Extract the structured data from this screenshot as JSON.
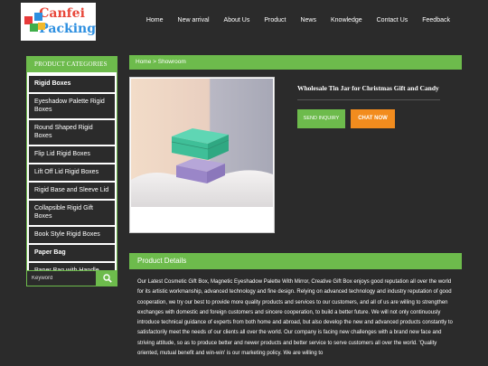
{
  "logo": {
    "line1": "Canfei",
    "line2": "Packing"
  },
  "nav": [
    "Home",
    "New arrival",
    "About Us",
    "Product",
    "News",
    "Knowledge",
    "Contact Us",
    "Feedback"
  ],
  "sidebar": {
    "heading": "PRODUCT CATEGORIES",
    "items": [
      {
        "label": "Rigid Boxes",
        "bold": true
      },
      {
        "label": "Eyeshadow Palette Rigid Boxes",
        "bold": false
      },
      {
        "label": "Round Shaped Rigid Boxes",
        "bold": false
      },
      {
        "label": "Flip Lid Rigid Boxes",
        "bold": false
      },
      {
        "label": "Lift Off Lid Rigid Boxes",
        "bold": false
      },
      {
        "label": "Rigid Base and Sleeve Lid",
        "bold": false
      },
      {
        "label": "Collapsible Rigid Gift Boxes",
        "bold": false
      },
      {
        "label": "Book Style Rigid Boxes",
        "bold": false
      },
      {
        "label": "Paper Bag",
        "bold": true
      },
      {
        "label": "Paper Bag with Handle",
        "bold": false
      }
    ]
  },
  "search": {
    "placeholder": "Keyword"
  },
  "breadcrumb": "Home > Showroom",
  "product": {
    "title": "Wholesale Tin Jar for Christmas Gift and Candy",
    "inquiry_label": "SEND INQUIRY",
    "chat_label": "CHAT NOW"
  },
  "details": {
    "heading": "Product Details",
    "text": "Our Latest Cosmetic Gift Box, Magnetic Eyeshadow Palette With Mirror, Creative Gift Box enjoys good reputation all over the world for its artistic workmanship, advanced technology and fine design. Relying on advanced technology and industry reputation of good cooperation, we try our best to provide more quality products and services to our customers, and all of us are willing to strengthen exchanges with domestic and foreign customers and sincere cooperation, to build a better future. We will not only continuously introduce technical guidance of experts from both home and abroad, but also develop the new and advanced products constantly to satisfactorily meet the needs of our clients all over the world. Our company is facing new challenges with a brand new face and striving attitude, so as to produce better and newer products and better service to serve customers all over the world. 'Quality oriented, mutual benefit and win-win' is our marketing policy. We are willing to"
  }
}
